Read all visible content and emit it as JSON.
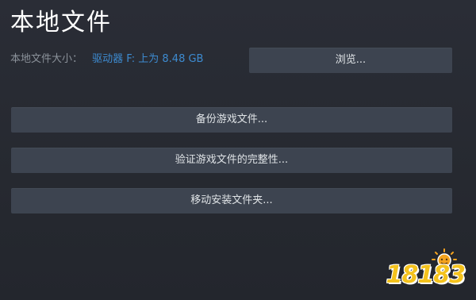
{
  "page": {
    "title": "本地文件",
    "size_label": "本地文件大小：",
    "size_value": "驱动器 F: 上为 8.48 GB",
    "buttons": {
      "browse": "浏览...",
      "backup": "备份游戏文件...",
      "verify": "验证游戏文件的完整性...",
      "move": "移动安装文件夹..."
    }
  },
  "watermark": {
    "text": "18183",
    "icon": "sun-mascot-icon"
  },
  "colors": {
    "background": "#252830",
    "button": "#3d4450",
    "link": "#3d8bd0",
    "watermark": "#f4c21d"
  }
}
